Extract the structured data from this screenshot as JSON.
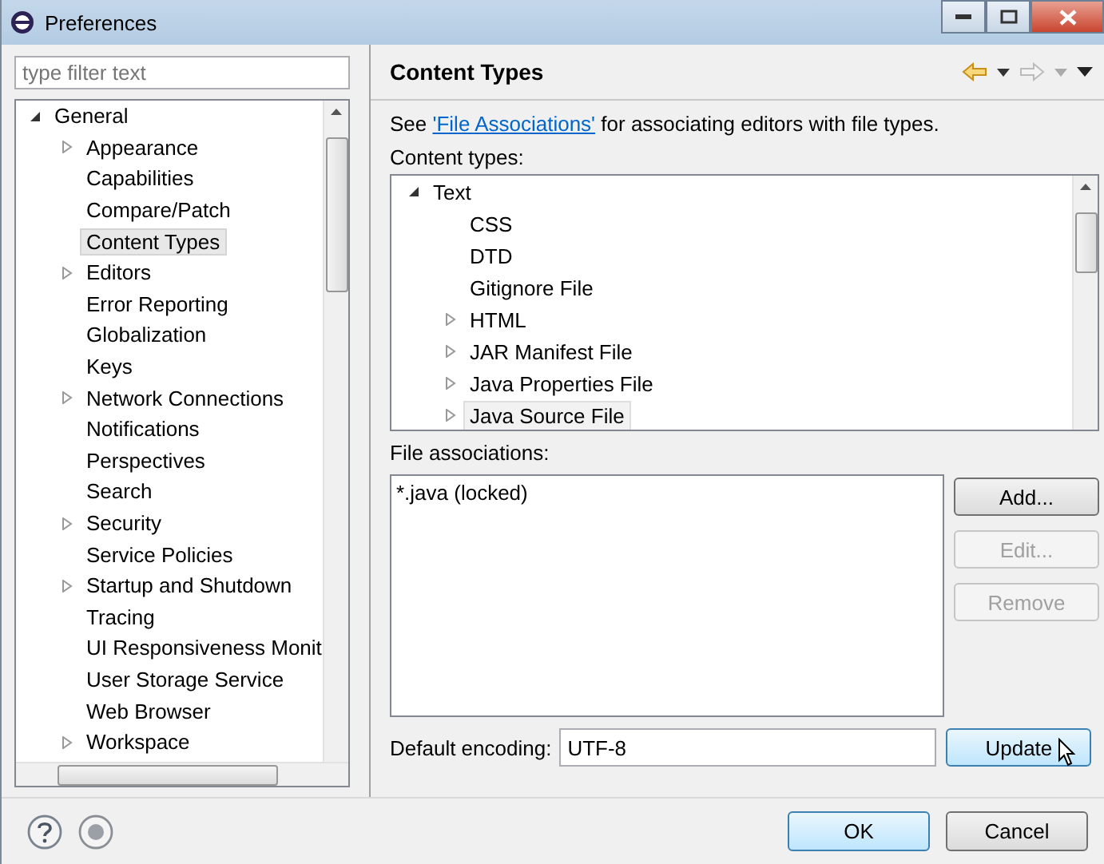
{
  "window": {
    "title": "Preferences"
  },
  "filter": {
    "placeholder": "type filter text"
  },
  "tree": [
    {
      "label": "General",
      "kind": "folder",
      "expanded": true,
      "selected": false,
      "children": [
        {
          "label": "Appearance",
          "kind": "folder",
          "expanded": false,
          "selected": false
        },
        {
          "label": "Capabilities",
          "kind": "leaf",
          "selected": false
        },
        {
          "label": "Compare/Patch",
          "kind": "leaf",
          "selected": false
        },
        {
          "label": "Content Types",
          "kind": "leaf",
          "selected": true
        },
        {
          "label": "Editors",
          "kind": "folder",
          "expanded": false,
          "selected": false
        },
        {
          "label": "Error Reporting",
          "kind": "leaf",
          "selected": false
        },
        {
          "label": "Globalization",
          "kind": "leaf",
          "selected": false
        },
        {
          "label": "Keys",
          "kind": "leaf",
          "selected": false
        },
        {
          "label": "Network Connections",
          "kind": "folder",
          "expanded": false,
          "selected": false
        },
        {
          "label": "Notifications",
          "kind": "leaf",
          "selected": false
        },
        {
          "label": "Perspectives",
          "kind": "leaf",
          "selected": false
        },
        {
          "label": "Search",
          "kind": "leaf",
          "selected": false
        },
        {
          "label": "Security",
          "kind": "folder",
          "expanded": false,
          "selected": false
        },
        {
          "label": "Service Policies",
          "kind": "leaf",
          "selected": false
        },
        {
          "label": "Startup and Shutdown",
          "kind": "folder",
          "expanded": false,
          "selected": false
        },
        {
          "label": "Tracing",
          "kind": "leaf",
          "selected": false
        },
        {
          "label": "UI Responsiveness Monit",
          "kind": "leaf",
          "selected": false
        },
        {
          "label": "User Storage Service",
          "kind": "leaf",
          "selected": false
        },
        {
          "label": "Web Browser",
          "kind": "leaf",
          "selected": false
        },
        {
          "label": "Workspace",
          "kind": "folder",
          "expanded": false,
          "selected": false
        }
      ]
    }
  ],
  "page": {
    "title": "Content Types",
    "intro": {
      "before": "See ",
      "link": "'File Associations'",
      "after": " for associating editors with file types."
    },
    "content_types_label": "Content types:",
    "content_types": [
      {
        "label": "Text",
        "kind": "folder",
        "expanded": true,
        "selected": false,
        "children": [
          {
            "label": "CSS",
            "kind": "leaf",
            "selected": false
          },
          {
            "label": "DTD",
            "kind": "leaf",
            "selected": false
          },
          {
            "label": "Gitignore File",
            "kind": "leaf",
            "selected": false
          },
          {
            "label": "HTML",
            "kind": "folder",
            "expanded": false,
            "selected": false
          },
          {
            "label": "JAR Manifest File",
            "kind": "folder",
            "expanded": false,
            "selected": false
          },
          {
            "label": "Java Properties File",
            "kind": "folder",
            "expanded": false,
            "selected": false
          },
          {
            "label": "Java Source File",
            "kind": "folder",
            "expanded": false,
            "selected": true
          }
        ]
      }
    ],
    "file_associations_label": "File associations:",
    "file_associations": [
      "*.java (locked)"
    ],
    "side_buttons": [
      {
        "label": "Add...",
        "disabled": false
      },
      {
        "label": "Edit...",
        "disabled": true
      },
      {
        "label": "Remove",
        "disabled": true
      }
    ],
    "encoding": {
      "label": "Default encoding:",
      "value": "UTF-8"
    },
    "update_button": {
      "label": "Update",
      "highlighted": true
    }
  },
  "footer_buttons": [
    {
      "label": "OK",
      "highlighted": true
    },
    {
      "label": "Cancel",
      "highlighted": false
    }
  ]
}
